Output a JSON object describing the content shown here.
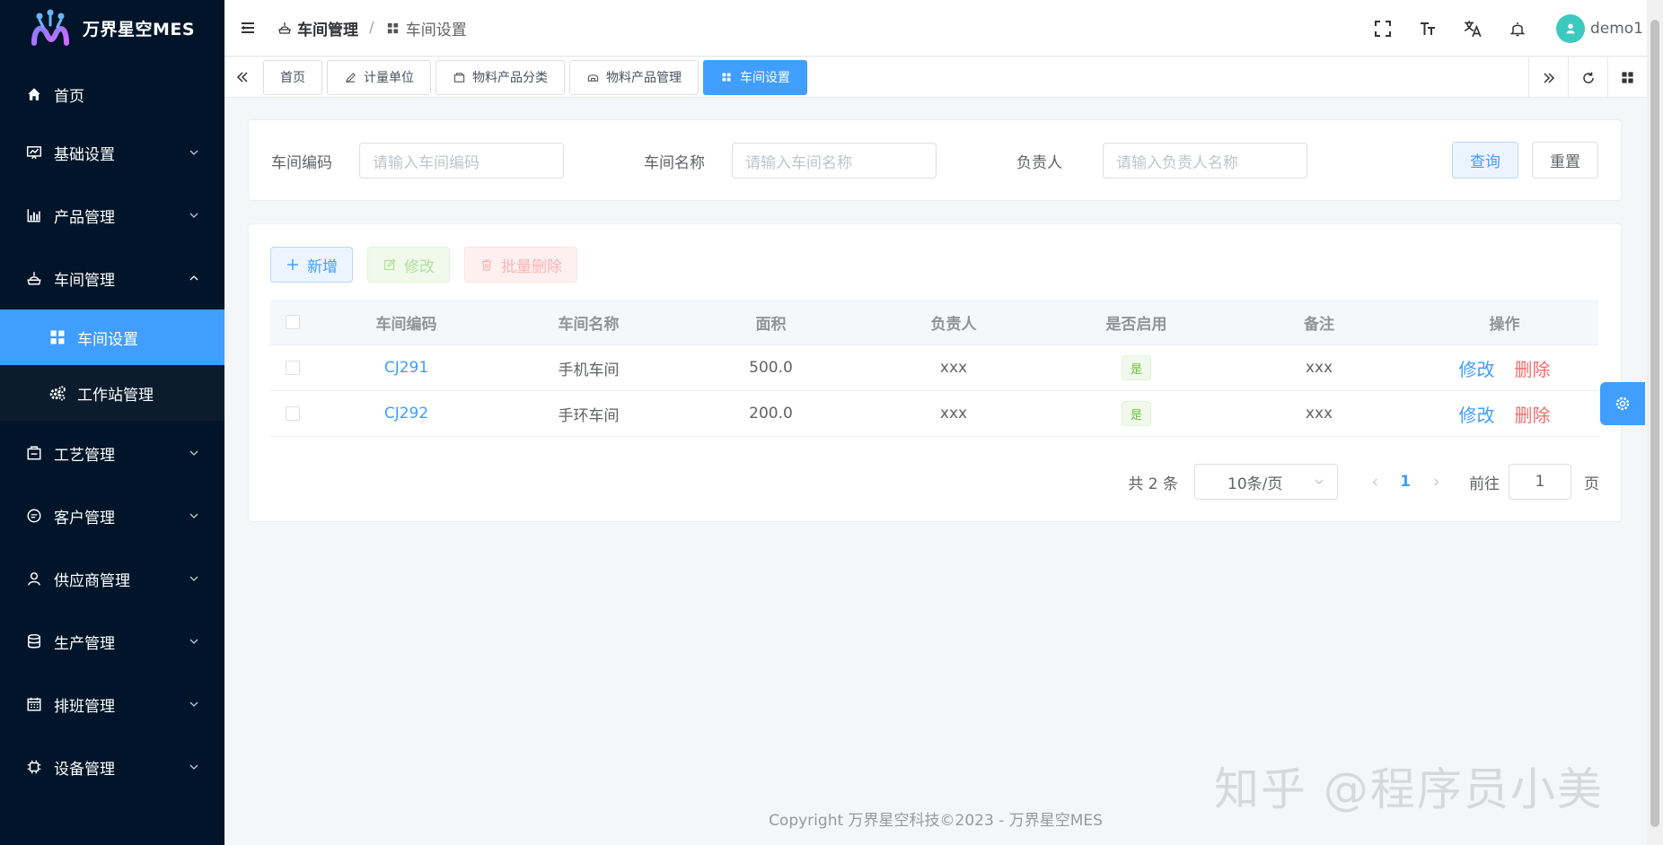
{
  "app": {
    "name": "万界星空MES"
  },
  "sidebar": {
    "items": [
      {
        "label": "首页",
        "icon": "home-icon",
        "expandable": false
      },
      {
        "label": "基础设置",
        "icon": "chart-board-icon",
        "expandable": true
      },
      {
        "label": "产品管理",
        "icon": "bar-chart-icon",
        "expandable": true
      },
      {
        "label": "车间管理",
        "icon": "workshop-icon",
        "expandable": true,
        "expanded": true
      },
      {
        "label": "工艺管理",
        "icon": "process-icon",
        "expandable": true
      },
      {
        "label": "客户管理",
        "icon": "chat-icon",
        "expandable": true
      },
      {
        "label": "供应商管理",
        "icon": "user-icon",
        "expandable": true
      },
      {
        "label": "生产管理",
        "icon": "database-icon",
        "expandable": true
      },
      {
        "label": "排班管理",
        "icon": "calendar-icon",
        "expandable": true
      },
      {
        "label": "设备管理",
        "icon": "chip-icon",
        "expandable": true
      }
    ],
    "subitems": [
      {
        "label": "车间设置",
        "icon": "grid-icon",
        "active": true
      },
      {
        "label": "工作站管理",
        "icon": "gears-icon",
        "active": false
      }
    ]
  },
  "header": {
    "breadcrumb": [
      {
        "label": "车间管理",
        "icon": "workshop-icon"
      },
      {
        "label": "车间设置",
        "icon": "grid-icon"
      }
    ],
    "separator": "/",
    "username": "demo1"
  },
  "tags": [
    {
      "label": "首页",
      "icon": "",
      "active": false
    },
    {
      "label": "计量单位",
      "icon": "pen-icon",
      "active": false
    },
    {
      "label": "物料产品分类",
      "icon": "box-icon",
      "active": false
    },
    {
      "label": "物料产品管理",
      "icon": "package-icon",
      "active": false
    },
    {
      "label": "车间设置",
      "icon": "grid-icon",
      "active": true
    }
  ],
  "search": {
    "code_label": "车间编码",
    "code_placeholder": "请输入车间编码",
    "name_label": "车间名称",
    "name_placeholder": "请输入车间名称",
    "owner_label": "负责人",
    "owner_placeholder": "请输入负责人名称",
    "query_label": "查询",
    "reset_label": "重置"
  },
  "toolbar": {
    "add_label": "新增",
    "edit_label": "修改",
    "batch_delete_label": "批量删除"
  },
  "table": {
    "columns": [
      "车间编码",
      "车间名称",
      "面积",
      "负责人",
      "是否启用",
      "备注",
      "操作"
    ],
    "rows": [
      {
        "code": "CJ291",
        "name": "手机车间",
        "area": "500.0",
        "owner": "xxx",
        "enabled": "是",
        "remark": "xxx",
        "edit": "修改",
        "delete": "删除"
      },
      {
        "code": "CJ292",
        "name": "手环车间",
        "area": "200.0",
        "owner": "xxx",
        "enabled": "是",
        "remark": "xxx",
        "edit": "修改",
        "delete": "删除"
      }
    ]
  },
  "pagination": {
    "total_text": "共 2 条",
    "page_size": "10条/页",
    "current_page": "1",
    "goto_label": "前往",
    "goto_value": "1",
    "page_suffix": "页"
  },
  "footer": {
    "copyright": "Copyright 万界星空科技©2023 - 万界星空MES"
  },
  "watermark": "知乎 @程序员小美",
  "colors": {
    "primary": "#409eff",
    "sidebar_bg": "#001529",
    "danger": "#f56c6c",
    "success": "#67c23a"
  }
}
